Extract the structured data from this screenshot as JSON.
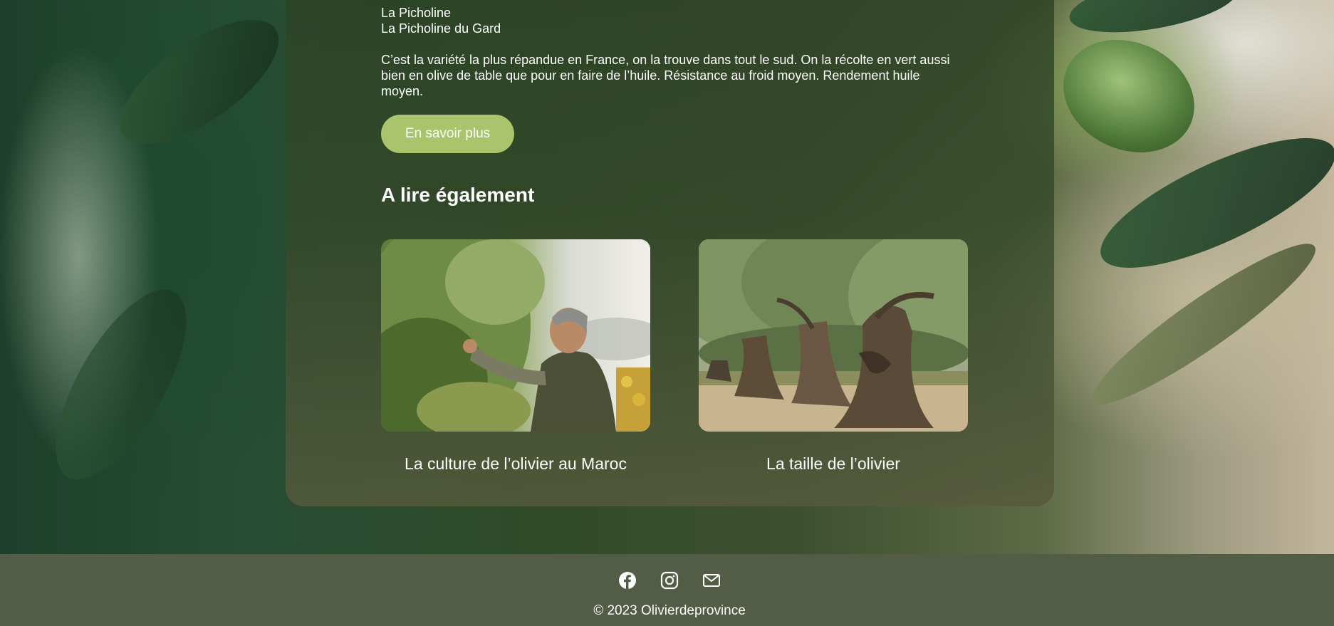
{
  "variety": {
    "name": "La Picholine",
    "alt_name": "La Picholine du Gard",
    "description": "C’est la variété la plus répandue en France, on la trouve dans tout le sud. On la récolte en vert aussi bien en olive de table que pour en faire de l’huile. Résistance au froid moyen. Rendement huile moyen.",
    "cta_label": "En savoir plus"
  },
  "related": {
    "title": "A lire également",
    "articles": [
      {
        "title": "La culture de l’olivier au Maroc"
      },
      {
        "title": "La taille de l’olivier"
      }
    ]
  },
  "footer": {
    "social_icons": [
      "facebook-icon",
      "instagram-icon",
      "mail-icon"
    ],
    "copyright": "© 2023 Olivierdeprovince"
  },
  "colors": {
    "button": "#a9c46a",
    "footer": "#535c44",
    "panel": "#3a5030"
  }
}
